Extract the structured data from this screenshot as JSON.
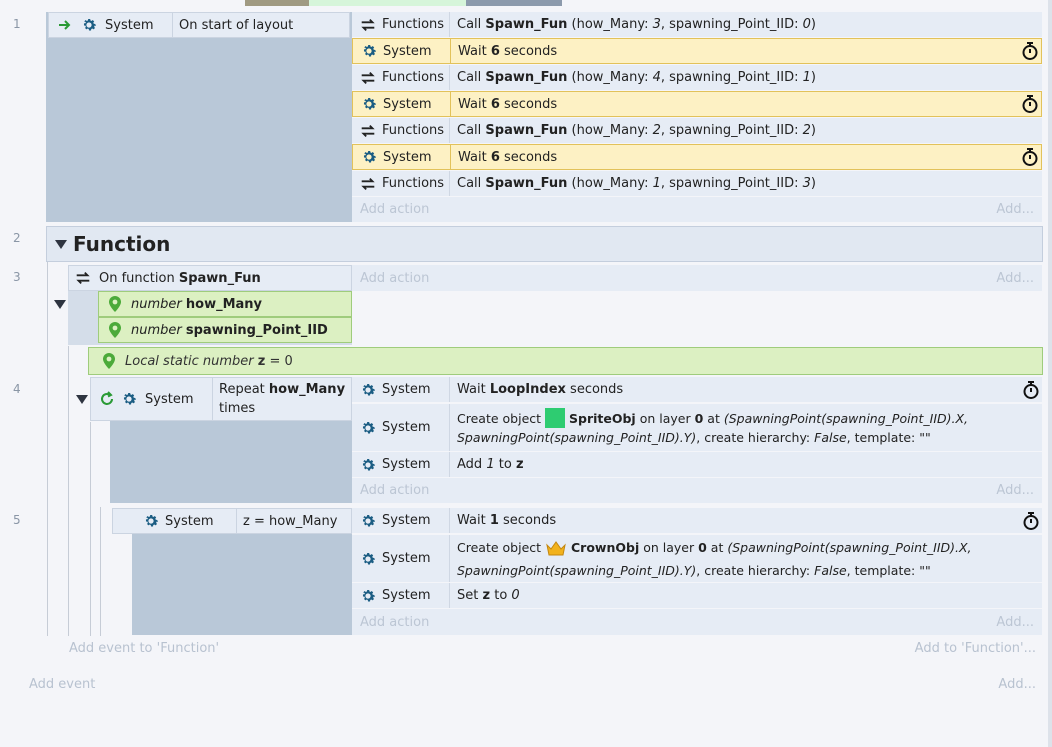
{
  "line_numbers": [
    "1",
    "2",
    "3",
    "4",
    "5"
  ],
  "event1": {
    "object": "System",
    "condition": "On start of layout",
    "actions": [
      {
        "object": "Functions",
        "verb": "Call",
        "func": "Spawn_Fun",
        "args": "(how_Many: ",
        "a1": "3",
        "mid": ", spawning_Point_IID: ",
        "a2": "0",
        "end": ")"
      },
      {
        "object": "System",
        "wait_pre": "Wait",
        "wait_val": "6",
        "wait_post": "seconds"
      },
      {
        "object": "Functions",
        "verb": "Call",
        "func": "Spawn_Fun",
        "args": "(how_Many: ",
        "a1": "4",
        "mid": ", spawning_Point_IID: ",
        "a2": "1",
        "end": ")"
      },
      {
        "object": "System",
        "wait_pre": "Wait",
        "wait_val": "6",
        "wait_post": "seconds"
      },
      {
        "object": "Functions",
        "verb": "Call",
        "func": "Spawn_Fun",
        "args": "(how_Many: ",
        "a1": "2",
        "mid": ", spawning_Point_IID: ",
        "a2": "2",
        "end": ")"
      },
      {
        "object": "System",
        "wait_pre": "Wait",
        "wait_val": "6",
        "wait_post": "seconds"
      },
      {
        "object": "Functions",
        "verb": "Call",
        "func": "Spawn_Fun",
        "args": "(how_Many: ",
        "a1": "1",
        "mid": ", spawning_Point_IID: ",
        "a2": "3",
        "end": ")"
      }
    ],
    "add_action": "Add action",
    "add_more": "Add..."
  },
  "group": {
    "title": "Function"
  },
  "event3": {
    "prefix": "On function",
    "func": "Spawn_Fun",
    "params": [
      {
        "type": "number",
        "name": "how_Many"
      },
      {
        "type": "number",
        "name": "spawning_Point_IID"
      }
    ],
    "add_action": "Add action",
    "add_more": "Add..."
  },
  "local_var": {
    "prefix": "Local static number",
    "name": "z",
    "suffix": "= 0"
  },
  "event4": {
    "object": "System",
    "cond_pre": "Repeat",
    "cond_var": "how_Many",
    "cond_post": "times",
    "wait_pre": "Wait",
    "wait_val": "LoopIndex",
    "wait_post": "seconds",
    "create_pre": "Create object",
    "create_obj": "SpriteObj",
    "create_layer_pre": "on layer",
    "create_layer": "0",
    "create_at": "at",
    "create_x": "(SpawningPoint(spawning_Point_IID).X,",
    "create_y": "SpawningPoint(spawning_Point_IID).Y)",
    "create_hier": ", create hierarchy:",
    "create_false": "False",
    "create_tpl": ", template: \"\"",
    "add_pre": "Add",
    "add_val": "1",
    "add_to": "to",
    "add_var": "z",
    "add_action": "Add action",
    "add_more": "Add..."
  },
  "event5": {
    "object": "System",
    "condition": "z = how_Many",
    "wait_pre": "Wait",
    "wait_val": "1",
    "wait_post": "seconds",
    "create_pre": "Create object",
    "create_obj": "CrownObj",
    "create_layer_pre": "on layer",
    "create_layer": "0",
    "create_at": "at",
    "create_x": "(SpawningPoint(spawning_Point_IID).X,",
    "create_y": "SpawningPoint(spawning_Point_IID).Y)",
    "create_hier": ", create hierarchy:",
    "create_false": "False",
    "create_tpl": ", template: \"\"",
    "set_pre": "Set",
    "set_var": "z",
    "set_to": "to",
    "set_val": "0",
    "add_action": "Add action",
    "add_more": "Add..."
  },
  "footer": {
    "add_event_function": "Add event to 'Function'",
    "add_to_function": "Add to 'Function'...",
    "add_event": "Add event",
    "add_more": "Add..."
  },
  "colors": {
    "wait_bg": "#fdf1c4",
    "param_bg": "#dcf0c2",
    "row_bg": "#e6ecf5",
    "condition_block": "#b9c8d8",
    "gear": "#1b5d83",
    "sprite_swatch": "#2ecc71"
  },
  "icons": {
    "system": "gear-icon",
    "functions": "swap-arrows-icon",
    "wait": "stopwatch-icon",
    "param": "map-pin-icon",
    "trigger": "green-arrow-icon",
    "loop": "loop-icon",
    "crown": "crown-icon"
  }
}
